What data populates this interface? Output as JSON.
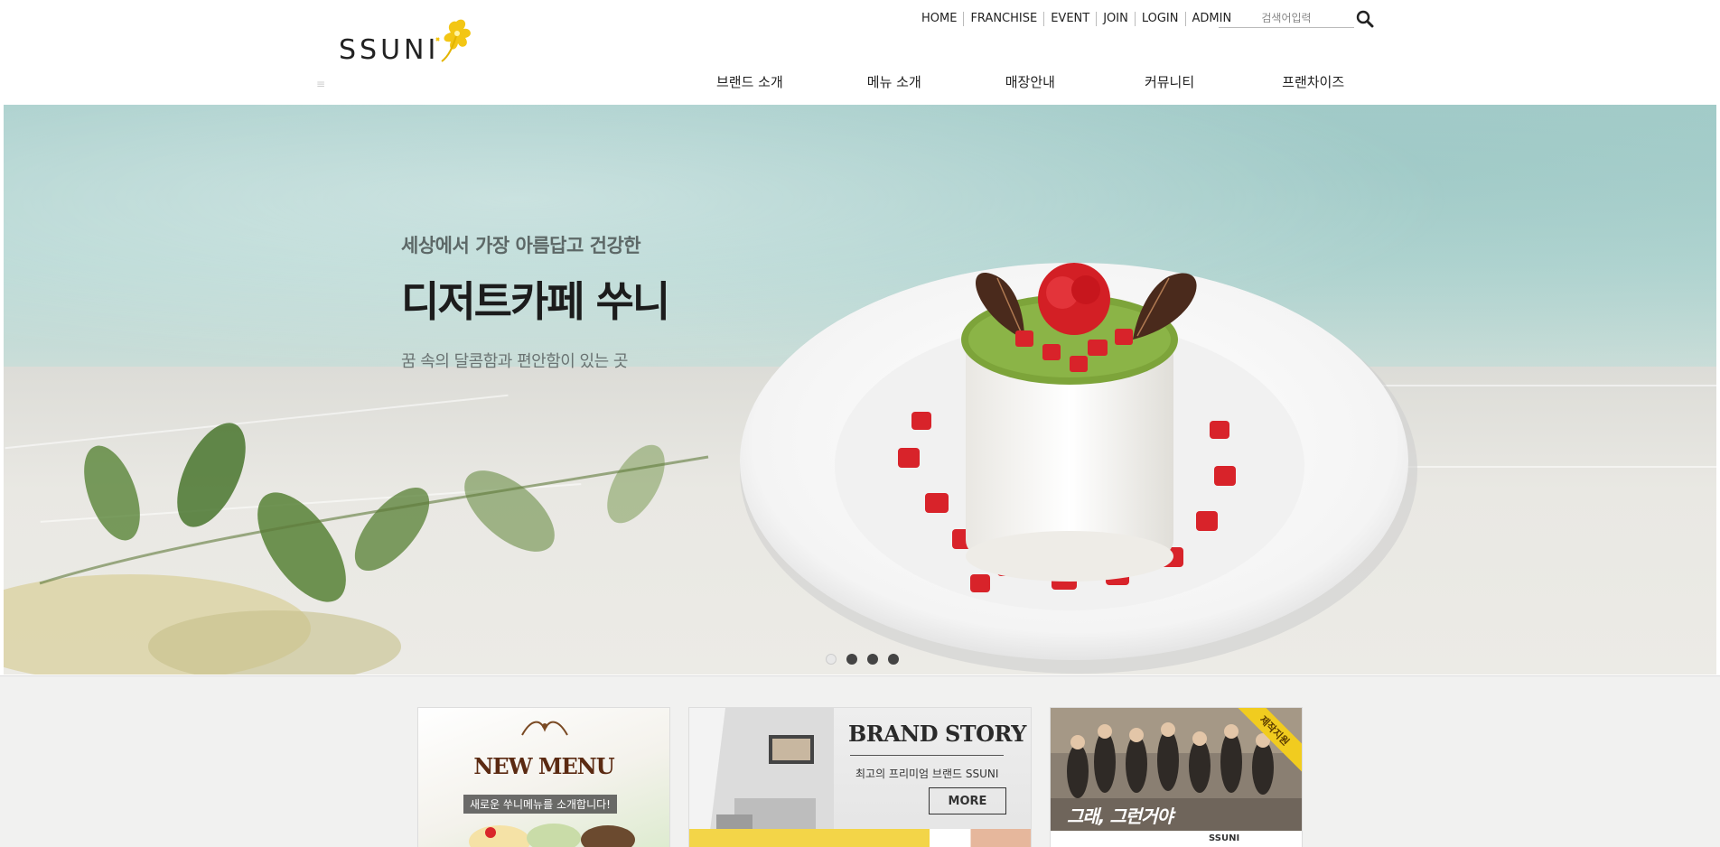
{
  "brand": {
    "logo_text": "SSUNI"
  },
  "utility_nav": [
    {
      "label": "HOME"
    },
    {
      "label": "FRANCHISE"
    },
    {
      "label": "EVENT"
    },
    {
      "label": "JOIN"
    },
    {
      "label": "LOGIN"
    },
    {
      "label": "ADMIN"
    }
  ],
  "search": {
    "placeholder": "검색어입력",
    "icon": "search-icon"
  },
  "main_nav": [
    {
      "label": "브랜드 소개"
    },
    {
      "label": "메뉴 소개"
    },
    {
      "label": "매장안내"
    },
    {
      "label": "커뮤니티"
    },
    {
      "label": "프랜차이즈"
    }
  ],
  "hero": {
    "subtitle": "세상에서 가장 아름답고 건강한",
    "title": "디저트카페 쑤니",
    "description": "꿈 속의 달콤함과 편안함이 있는 곳",
    "slides_count": 4,
    "active_slide": 1
  },
  "cards": {
    "new_menu": {
      "title": "NEW MENU",
      "subtitle": "새로운 쑤니메뉴를 소개합니다!"
    },
    "brand_story": {
      "title": "BRAND STORY",
      "subtitle": "최고의 프리미엄 브랜드 SSUNI",
      "button": "MORE"
    },
    "drama": {
      "caption": "그래, 그런거야",
      "ribbon": "제작지원",
      "logo": "SSUNI"
    }
  },
  "colors": {
    "accent_yellow": "#f1cc1f",
    "hero_teal": "#a9cfcc",
    "text_dark": "#222222"
  }
}
